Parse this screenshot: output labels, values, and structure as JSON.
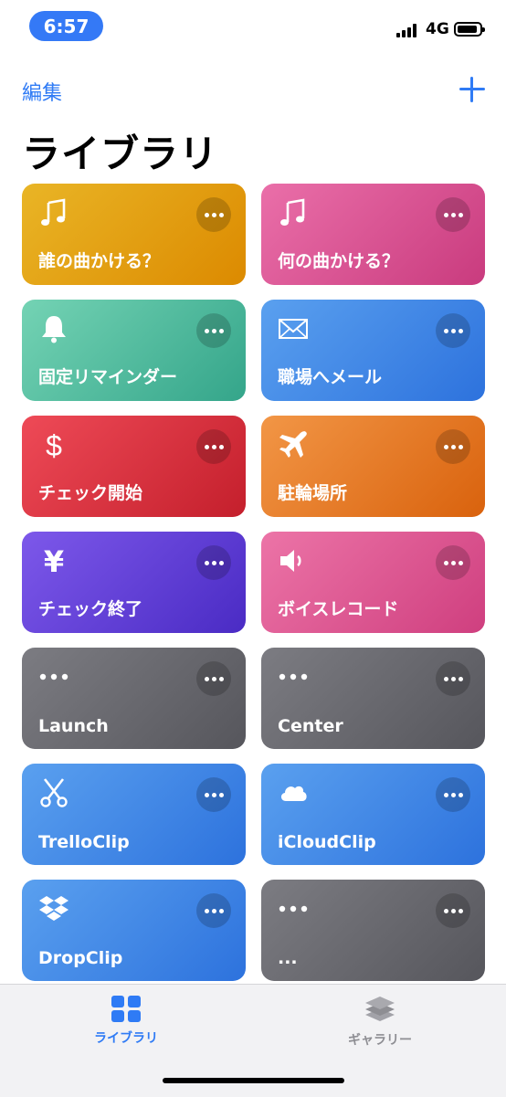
{
  "status_bar": {
    "time": "6:57",
    "network": "4G"
  },
  "header": {
    "edit_label": "編集",
    "title": "ライブラリ"
  },
  "shortcuts": [
    {
      "label": "誰の曲かける？",
      "icon": "music-note-icon",
      "colors": [
        "#e9b526",
        "#dc8a00"
      ]
    },
    {
      "label": "何の曲かける？",
      "icon": "music-note-icon",
      "colors": [
        "#ea6fa9",
        "#c93b7e"
      ]
    },
    {
      "label": "固定リマインダー",
      "icon": "bell-icon",
      "colors": [
        "#74d3b4",
        "#34a58a"
      ]
    },
    {
      "label": "職場へメール",
      "icon": "envelope-icon",
      "colors": [
        "#5aa0ef",
        "#2d72dd"
      ]
    },
    {
      "label": "チェック開始",
      "icon": "dollar-icon",
      "colors": [
        "#ee4a57",
        "#c41f2c"
      ]
    },
    {
      "label": "駐輪場所",
      "icon": "airplane-icon",
      "colors": [
        "#f29646",
        "#d9620d"
      ]
    },
    {
      "label": "チェック終了",
      "icon": "yen-icon",
      "colors": [
        "#7d58ea",
        "#4a2bc4"
      ]
    },
    {
      "label": "ボイスレコード",
      "icon": "speaker-icon",
      "colors": [
        "#ec74a7",
        "#cf3f7f"
      ]
    },
    {
      "label": "Launch",
      "icon": "ellipsis-icon",
      "colors": [
        "#7c7c82",
        "#56565c"
      ]
    },
    {
      "label": "Center",
      "icon": "ellipsis-icon",
      "colors": [
        "#7c7c82",
        "#56565c"
      ]
    },
    {
      "label": "TrelloClip",
      "icon": "scissors-icon",
      "colors": [
        "#5aa0ef",
        "#2d72dd"
      ]
    },
    {
      "label": "iCloudClip",
      "icon": "cloud-icon",
      "colors": [
        "#5aa0ef",
        "#2d72dd"
      ]
    },
    {
      "label": "DropClip",
      "icon": "dropbox-icon",
      "colors": [
        "#5aa0ef",
        "#2d72dd"
      ]
    },
    {
      "label": "...",
      "icon": "ellipsis-icon",
      "colors": [
        "#7c7c82",
        "#56565c"
      ]
    }
  ],
  "tab_bar": {
    "library_label": "ライブラリ",
    "gallery_label": "ギャラリー",
    "active_color": "#2f7bf5",
    "inactive_color": "#8e8e93"
  }
}
